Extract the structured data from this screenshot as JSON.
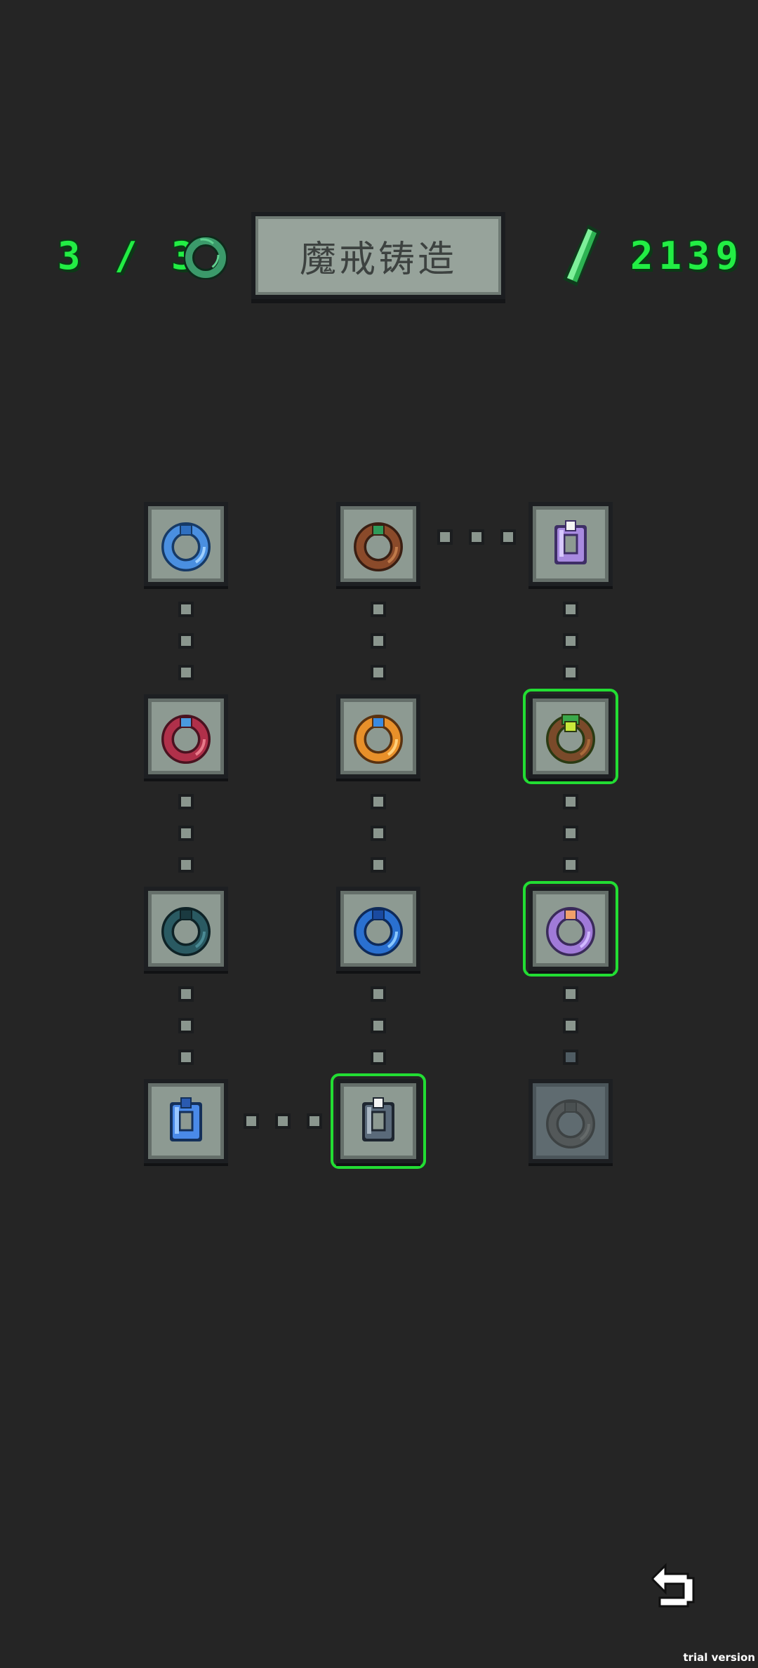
{
  "hud": {
    "ring_count": "3 / 3",
    "crystal_count": "2139",
    "ring_icon": "ring-icon",
    "crystal_icon": "green-crystal-icon"
  },
  "title": "魔戒铸造",
  "colors": {
    "background": "#252525",
    "hud_green": "#22ee44",
    "selection_border": "#22dd33",
    "node_fill": "#8d9a92",
    "locked_node_fill": "#5f6b70"
  },
  "rings": [
    {
      "id": "r1c1",
      "icon": "blue-ring-icon",
      "selected": false,
      "locked": false
    },
    {
      "id": "r1c2",
      "icon": "brown-green-ring-icon",
      "selected": false,
      "locked": false
    },
    {
      "id": "r1c3",
      "icon": "purple-white-ring-icon",
      "selected": false,
      "locked": false
    },
    {
      "id": "r2c1",
      "icon": "red-blue-ring-icon",
      "selected": false,
      "locked": false
    },
    {
      "id": "r2c2",
      "icon": "orange-blue-ring-icon",
      "selected": false,
      "locked": false
    },
    {
      "id": "r2c3",
      "icon": "green-yellow-ring-icon",
      "selected": true,
      "locked": false
    },
    {
      "id": "r3c1",
      "icon": "teal-ring-icon",
      "selected": false,
      "locked": false
    },
    {
      "id": "r3c2",
      "icon": "sapphire-ring-icon",
      "selected": false,
      "locked": false
    },
    {
      "id": "r3c3",
      "icon": "orange-purple-ring-icon",
      "selected": true,
      "locked": false
    },
    {
      "id": "r4c1",
      "icon": "blue-gem-ring-icon",
      "selected": false,
      "locked": false
    },
    {
      "id": "r4c2",
      "icon": "silver-ring-icon",
      "selected": true,
      "locked": false
    },
    {
      "id": "r4c3",
      "icon": "dark-ring-icon",
      "selected": false,
      "locked": true
    }
  ],
  "footer": {
    "back_icon": "back-arrow-icon",
    "trial_label": "trial version"
  }
}
